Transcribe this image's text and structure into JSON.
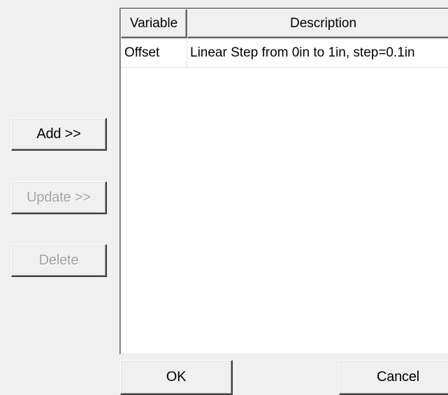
{
  "buttons": {
    "add": "Add >>",
    "update": "Update >>",
    "delete": "Delete",
    "ok": "OK",
    "cancel": "Cancel"
  },
  "table": {
    "columns": [
      "Variable",
      "Description"
    ],
    "rows": [
      [
        "Offset",
        "Linear Step from 0in to 1in, step=0.1in"
      ]
    ]
  },
  "colors": {
    "background": "#f0f0f0",
    "list_background": "#ffffff",
    "disabled_text": "#a0a0a0"
  }
}
